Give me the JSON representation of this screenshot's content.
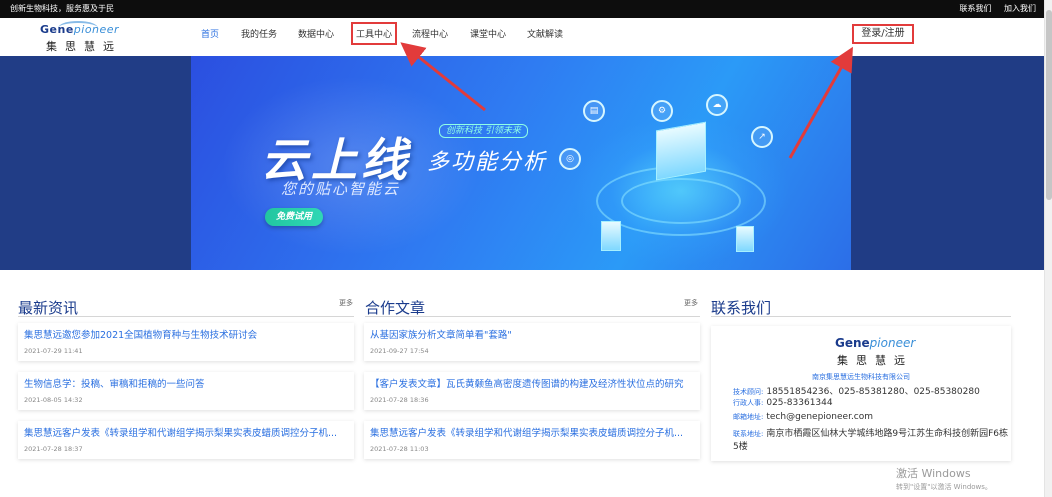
{
  "topbar": {
    "slogan": "创新生物科技，服务惠及于民",
    "contact_us": "联系我们",
    "join_us": "加入我们"
  },
  "logo": {
    "brand_a": "Gene",
    "brand_b": "pioneer",
    "cn": "集思慧远"
  },
  "nav": {
    "items": [
      {
        "label": "首页",
        "active": true,
        "boxed": false
      },
      {
        "label": "我的任务",
        "active": false,
        "boxed": false
      },
      {
        "label": "数据中心",
        "active": false,
        "boxed": false
      },
      {
        "label": "工具中心",
        "active": false,
        "boxed": true
      },
      {
        "label": "流程中心",
        "active": false,
        "boxed": false
      },
      {
        "label": "课堂中心",
        "active": false,
        "boxed": false
      },
      {
        "label": "文献解读",
        "active": false,
        "boxed": false
      }
    ],
    "login": "登录/注册"
  },
  "hero": {
    "headline": "云上线",
    "tag": "创新科技 引领未来",
    "subheadline": "多功能分析",
    "tagline": "您的贴心智能云",
    "cta": "免费试用"
  },
  "news": {
    "title": "最新资讯",
    "more": "更多",
    "items": [
      {
        "title": "集思慧远邀您参加2021全国植物育种与生物技术研讨会",
        "date": "2021-07-29 11:41"
      },
      {
        "title": "生物信息学：投稿、审稿和拒稿的一些问答",
        "date": "2021-08-05 14:32"
      },
      {
        "title": "集思慧远客户发表《转录组学和代谢组学揭示梨果实表皮蜡质调控分子机...",
        "date": "2021-07-28 18:37"
      }
    ]
  },
  "articles": {
    "title": "合作文章",
    "more": "更多",
    "items": [
      {
        "title": "从基因家族分析文章简单看\"套路\"",
        "date": "2021-09-27 17:54"
      },
      {
        "title": "【客户发表文章】瓦氏黄颡鱼高密度遗传图谱的构建及经济性状位点的研究",
        "date": "2021-07-28 18:36"
      },
      {
        "title": "集思慧远客户发表《转录组学和代谢组学揭示梨果实表皮蜡质调控分子机...",
        "date": "2021-07-28 11:03"
      }
    ]
  },
  "contact": {
    "title": "联系我们",
    "company": "南京集思慧远生物科技有限公司",
    "rows": [
      {
        "key": "技术顾问:",
        "value": "18551854236、025-85381280、025-85380280"
      },
      {
        "key": "行政人事:",
        "value": "025-83361344"
      },
      {
        "key": "邮箱地址:",
        "value": "tech@genepioneer.com"
      },
      {
        "key": "联系地址:",
        "value": "南京市栖霞区仙林大学城纬地路9号江苏生命科技创新园F6栋"
      },
      {
        "key": "",
        "value": "5楼"
      }
    ]
  },
  "watermark": {
    "line1": "激活 Windows",
    "line2": "转到\"设置\"以激活 Windows。"
  },
  "colors": {
    "accent_blue": "#2a6fe0",
    "brand_navy": "#1a3b8c",
    "highlight_red": "#e23b3b",
    "cta_green": "#22c6a0"
  }
}
